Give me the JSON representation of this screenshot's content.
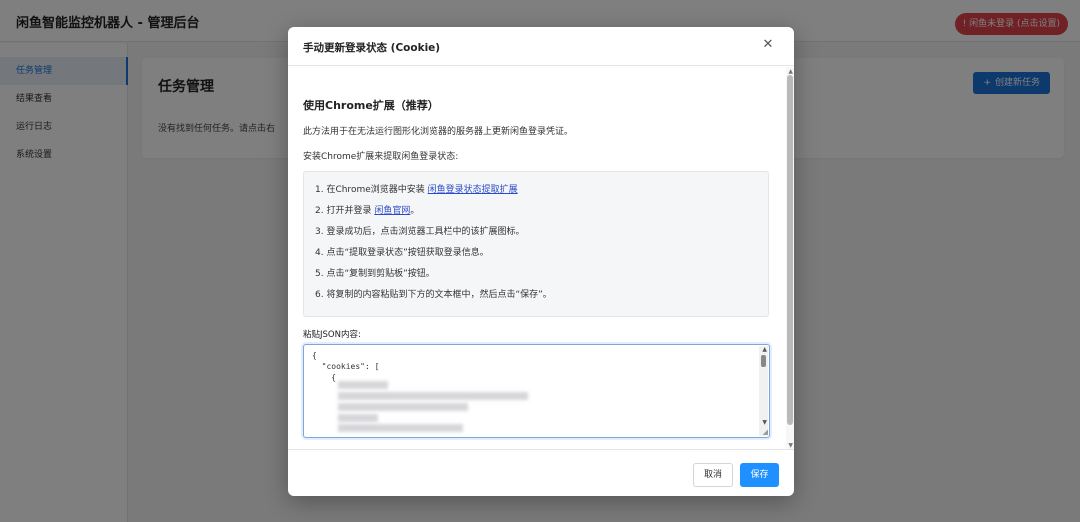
{
  "app": {
    "title": "闲鱼智能监控机器人 - 管理后台"
  },
  "header": {
    "login_status": "! 闲鱼未登录 (点击设置)"
  },
  "sidebar": {
    "items": [
      {
        "label": "任务管理",
        "active": true
      },
      {
        "label": "结果查看",
        "active": false
      },
      {
        "label": "运行日志",
        "active": false
      },
      {
        "label": "系统设置",
        "active": false
      }
    ]
  },
  "main": {
    "title": "任务管理",
    "empty_text": "没有找到任何任务。请点击右",
    "create_button": {
      "icon": "plus-icon",
      "label": "创建新任务"
    }
  },
  "modal": {
    "title": "手动更新登录状态 (Cookie)",
    "close_icon": "close-icon",
    "section_title": "使用Chrome扩展（推荐）",
    "description": "此方法用于在无法运行图形化浏览器的服务器上更新闲鱼登录凭证。",
    "install_label": "安装Chrome扩展来提取闲鱼登录状态:",
    "steps": [
      {
        "prefix": "1. 在Chrome浏览器中安装 ",
        "link": "闲鱼登录状态提取扩展",
        "suffix": ""
      },
      {
        "prefix": "2. 打开并登录 ",
        "link": "闲鱼官网",
        "suffix": "。"
      },
      {
        "prefix": "3. 登录成功后，点击浏览器工具栏中的该扩展图标。",
        "link": "",
        "suffix": ""
      },
      {
        "prefix": "4. 点击“提取登录状态”按钮获取登录信息。",
        "link": "",
        "suffix": ""
      },
      {
        "prefix": "5. 点击“复制到剪贴板”按钮。",
        "link": "",
        "suffix": ""
      },
      {
        "prefix": "6. 将复制的内容粘贴到下方的文本框中，然后点击“保存”。",
        "link": "",
        "suffix": ""
      }
    ],
    "json_label": "粘贴JSON内容:",
    "json_lines": [
      "{",
      "  \"cookies\": [",
      "    {"
    ],
    "cancel_label": "取消",
    "save_label": "保存"
  },
  "colors": {
    "primary": "#1e90ff",
    "danger": "#e0424a",
    "link": "#2a4bc9",
    "nav_active": "#1a73d9"
  }
}
